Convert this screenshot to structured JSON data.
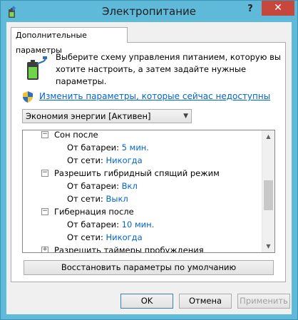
{
  "window": {
    "title": "Электропитание",
    "help": "?",
    "close": "✕"
  },
  "tab": {
    "label": "Дополнительные параметры"
  },
  "description": "Выберите схему управления питанием, которую вы хотите настроить, а затем задайте нужные параметры.",
  "change_link": "Изменить параметры, которые сейчас недоступны",
  "plan_select": {
    "value": "Экономия энергии [Активен]"
  },
  "tree": [
    {
      "type": "group",
      "label": "Сон после",
      "expander": "−"
    },
    {
      "type": "setting",
      "label": "От батареи:",
      "value": "5 мин."
    },
    {
      "type": "setting",
      "label": "От сети:",
      "value": "Никогда"
    },
    {
      "type": "group",
      "label": "Разрешить гибридный спящий режим",
      "expander": "−"
    },
    {
      "type": "setting",
      "label": "От батареи:",
      "value": "Вкл"
    },
    {
      "type": "setting",
      "label": "От сети:",
      "value": "Выкл"
    },
    {
      "type": "group",
      "label": "Гибернация после",
      "expander": "−"
    },
    {
      "type": "setting",
      "label": "От батареи:",
      "value": "10 мин."
    },
    {
      "type": "setting",
      "label": "От сети:",
      "value": "Никогда"
    },
    {
      "type": "group",
      "label": "Разрешить таймеры пробуждения",
      "expander": "+"
    }
  ],
  "buttons": {
    "restore": "Восстановить параметры по умолчанию",
    "ok": "OK",
    "cancel": "Отмена",
    "apply": "Применить"
  }
}
